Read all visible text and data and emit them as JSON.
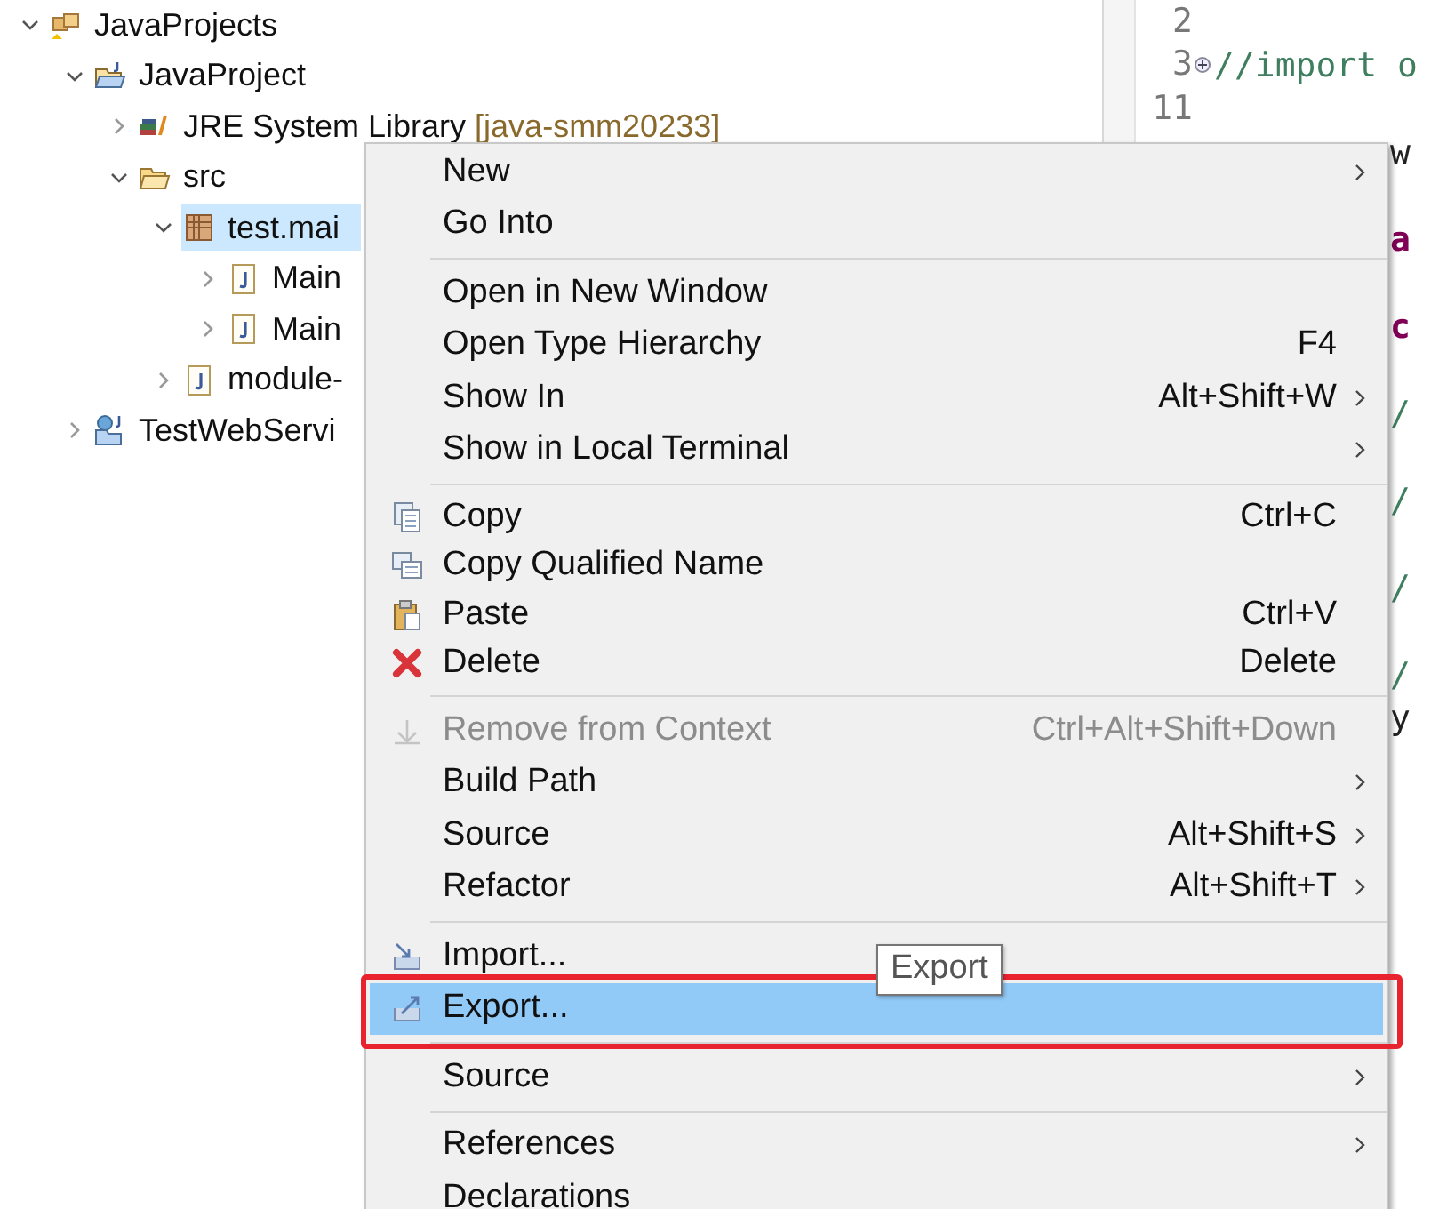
{
  "tree": [
    {
      "label": "JavaProjects",
      "expanded": true,
      "selected": false,
      "children": [
        {
          "label": "JavaProject",
          "expanded": true,
          "selected": false,
          "children": [
            {
              "label": "JRE System Library",
              "decoration": "[java-smm20233]",
              "expanded": false,
              "selected": false
            },
            {
              "label": "src",
              "expanded": true,
              "selected": false,
              "children": [
                {
                  "label": "test.mai",
                  "expanded": true,
                  "selected": true,
                  "children": [
                    {
                      "label": "Main",
                      "expanded": false,
                      "selected": false
                    },
                    {
                      "label": "Main",
                      "expanded": false,
                      "selected": false
                    }
                  ]
                },
                {
                  "label": "module-",
                  "expanded": false,
                  "selected": false
                }
              ]
            }
          ]
        },
        {
          "label": "TestWebServi",
          "expanded": false,
          "selected": false
        }
      ]
    }
  ],
  "editor": {
    "lines": [
      {
        "number": "2"
      },
      {
        "number": "3",
        "folded": true,
        "text": "//import o"
      },
      {
        "number": "11"
      }
    ],
    "fragments": [
      {
        "text": "w",
        "kind": "plain"
      },
      {
        "text": "a",
        "kind": "keyword"
      },
      {
        "text": "c",
        "kind": "keyword"
      },
      {
        "text": "/",
        "kind": "comment"
      },
      {
        "text": "/",
        "kind": "comment"
      },
      {
        "text": "/",
        "kind": "comment"
      },
      {
        "text": "/",
        "kind": "comment"
      },
      {
        "text": "y",
        "kind": "plain"
      }
    ]
  },
  "context_menu": {
    "items": [
      {
        "kind": "item",
        "label": "New",
        "submenu": true,
        "disabled": false,
        "selected": false
      },
      {
        "kind": "item",
        "label": "Go Into",
        "submenu": false,
        "disabled": false,
        "selected": false
      },
      {
        "kind": "separator"
      },
      {
        "kind": "item",
        "label": "Open in New Window",
        "submenu": false,
        "disabled": false,
        "selected": false
      },
      {
        "kind": "item",
        "label": "Open Type Hierarchy",
        "shortcut": "F4",
        "submenu": false,
        "disabled": false,
        "selected": false
      },
      {
        "kind": "item",
        "label": "Show In",
        "shortcut": "Alt+Shift+W",
        "submenu": true,
        "disabled": false,
        "selected": false
      },
      {
        "kind": "item",
        "label": "Show in Local Terminal",
        "submenu": true,
        "disabled": false,
        "selected": false
      },
      {
        "kind": "separator"
      },
      {
        "kind": "item",
        "label": "Copy",
        "shortcut": "Ctrl+C",
        "submenu": false,
        "disabled": false,
        "selected": false
      },
      {
        "kind": "item",
        "label": "Copy Qualified Name",
        "submenu": false,
        "disabled": false,
        "selected": false
      },
      {
        "kind": "item",
        "label": "Paste",
        "shortcut": "Ctrl+V",
        "submenu": false,
        "disabled": false,
        "selected": false
      },
      {
        "kind": "item",
        "label": "Delete",
        "shortcut": "Delete",
        "submenu": false,
        "disabled": false,
        "selected": false
      },
      {
        "kind": "separator"
      },
      {
        "kind": "item",
        "label": "Remove from Context",
        "shortcut": "Ctrl+Alt+Shift+Down",
        "submenu": false,
        "disabled": true,
        "selected": false
      },
      {
        "kind": "item",
        "label": "Build Path",
        "submenu": true,
        "disabled": false,
        "selected": false
      },
      {
        "kind": "item",
        "label": "Source",
        "shortcut": "Alt+Shift+S",
        "submenu": true,
        "disabled": false,
        "selected": false
      },
      {
        "kind": "item",
        "label": "Refactor",
        "shortcut": "Alt+Shift+T",
        "submenu": true,
        "disabled": false,
        "selected": false
      },
      {
        "kind": "separator"
      },
      {
        "kind": "item",
        "label": "Import...",
        "submenu": false,
        "disabled": false,
        "selected": false
      },
      {
        "kind": "item",
        "label": "Export...",
        "submenu": false,
        "disabled": false,
        "selected": true
      },
      {
        "kind": "separator"
      },
      {
        "kind": "item",
        "label": "Source",
        "submenu": true,
        "disabled": false,
        "selected": false
      },
      {
        "kind": "separator"
      },
      {
        "kind": "item",
        "label": "References",
        "submenu": true,
        "disabled": false,
        "selected": false
      },
      {
        "kind": "item",
        "label": "Declarations",
        "submenu": false,
        "disabled": false,
        "selected": false
      }
    ]
  },
  "tooltip": {
    "text": "Export"
  }
}
